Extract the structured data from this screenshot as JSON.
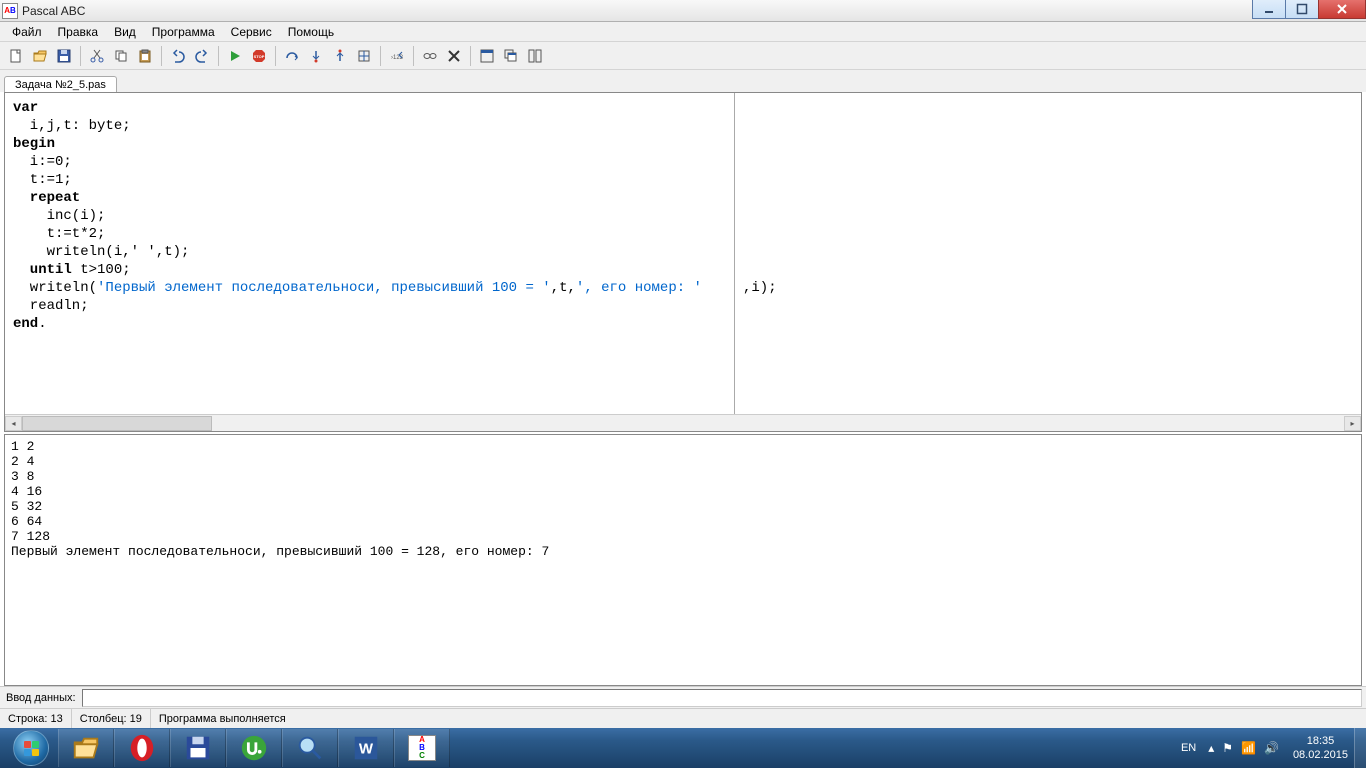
{
  "titlebar": {
    "app_name": "Pascal ABC"
  },
  "menu": {
    "items": [
      "Файл",
      "Правка",
      "Вид",
      "Программа",
      "Сервис",
      "Помощь"
    ]
  },
  "toolbar": {
    "buttons": [
      "new-file",
      "open-file",
      "save-file",
      "sep",
      "cut",
      "copy",
      "paste",
      "sep",
      "undo",
      "redo",
      "sep",
      "run",
      "stop",
      "sep",
      "step-over",
      "step-into",
      "step-out",
      "goto-cursor",
      "sep",
      "breakpoint",
      "sep",
      "watch",
      "eval",
      "clear",
      "sep",
      "window-tile",
      "window-cascade",
      "window-arrange"
    ]
  },
  "file_tab": {
    "active": "Задача №2_5.pas"
  },
  "code": {
    "lines": [
      {
        "t": "kw",
        "s": "var"
      },
      {
        "t": "",
        "s": "  i,j,t: byte;"
      },
      {
        "t": "kw",
        "s": "begin"
      },
      {
        "t": "",
        "s": "  i:=0;"
      },
      {
        "t": "",
        "s": "  t:=1;"
      },
      {
        "t": "kw",
        "s": "  repeat"
      },
      {
        "t": "",
        "s": "    inc(i);"
      },
      {
        "t": "",
        "s": "    t:=t*2;"
      },
      {
        "t": "",
        "s": "    writeln(i,' ',t);"
      },
      {
        "t": "kw",
        "s": "  until ",
        "tail": "t>100;"
      },
      {
        "t": "writeln_str",
        "pre": "  writeln(",
        "str": "'Первый элемент последовательноси, превысивший 100 = '",
        "mid": ",t,",
        "str2": "', его номер: '",
        "post": ",i);"
      },
      {
        "t": "",
        "s": "  readln;"
      },
      {
        "t": "kw",
        "s": "end",
        "tail": "."
      }
    ]
  },
  "output": [
    "1 2",
    "2 4",
    "3 8",
    "4 16",
    "5 32",
    "6 64",
    "7 128",
    "Первый элемент последовательноси, превысивший 100 = 128, его номер: 7"
  ],
  "input_row": {
    "label": "Ввод данных:"
  },
  "status": {
    "line_label": "Строка:",
    "line_value": "13",
    "col_label": "Столбец:",
    "col_value": "19",
    "message": "Программа выполняется"
  },
  "tray": {
    "lang": "EN",
    "time": "18:35",
    "date": "08.02.2015"
  }
}
